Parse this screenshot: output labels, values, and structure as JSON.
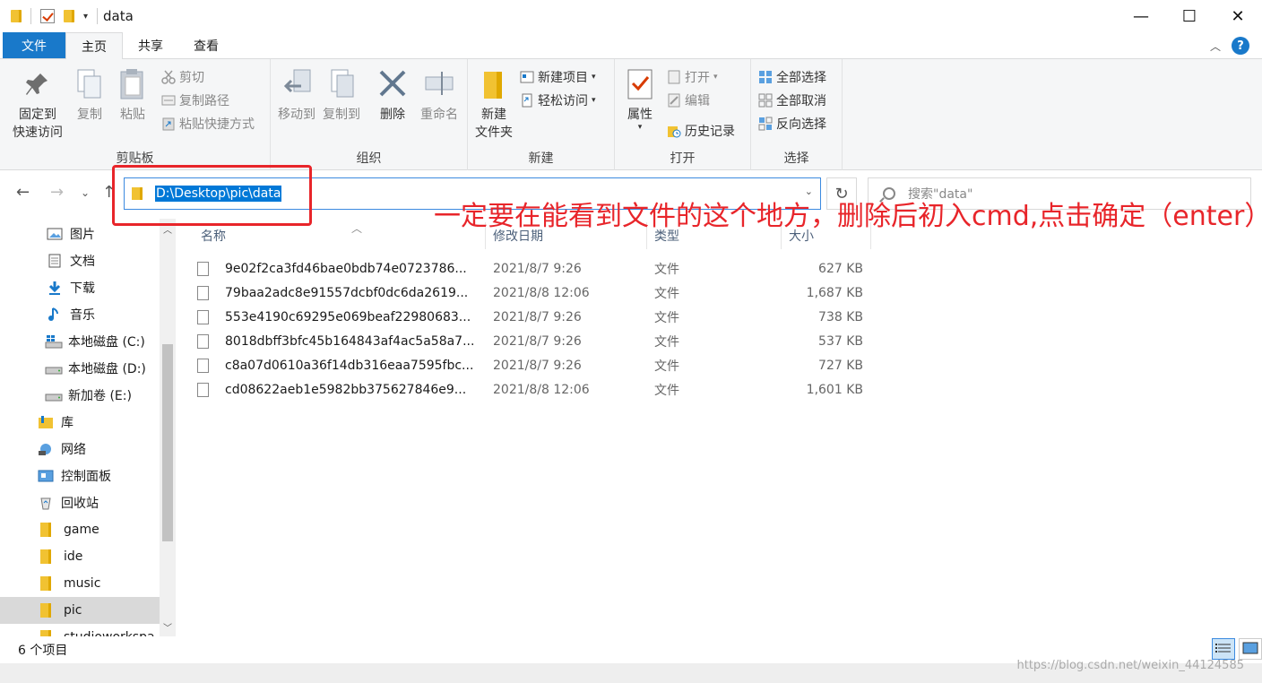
{
  "window": {
    "title": "data",
    "controls": {
      "minimize": "—",
      "maximize": "☐",
      "close": "✕"
    }
  },
  "ribbon_tabs": [
    {
      "label": "文件"
    },
    {
      "label": "主页"
    },
    {
      "label": "共享"
    },
    {
      "label": "查看"
    }
  ],
  "ribbon": {
    "clipboard": {
      "pin_line1": "固定到",
      "pin_line2": "快速访问",
      "copy": "复制",
      "paste": "粘贴",
      "cut": "剪切",
      "copy_path": "复制路径",
      "paste_shortcut": "粘贴快捷方式",
      "label": "剪贴板"
    },
    "organize": {
      "move_to": "移动到",
      "copy_to": "复制到",
      "delete": "删除",
      "rename": "重命名",
      "label": "组织"
    },
    "new": {
      "new_folder_line1": "新建",
      "new_folder_line2": "文件夹",
      "new_item": "新建项目",
      "easy_access": "轻松访问",
      "label": "新建"
    },
    "open": {
      "properties": "属性",
      "open": "打开",
      "edit": "编辑",
      "history": "历史记录",
      "label": "打开"
    },
    "select": {
      "select_all": "全部选择",
      "select_none": "全部取消",
      "invert": "反向选择",
      "label": "选择"
    }
  },
  "address_bar": {
    "path": "D:\\Desktop\\pic\\data"
  },
  "search": {
    "placeholder": "搜索\"data\""
  },
  "annotation": "一定要在能看到文件的这个地方，删除后初入cmd,点击确定（enter）",
  "nav_pane": [
    {
      "label": "图片"
    },
    {
      "label": "文档"
    },
    {
      "label": "下载"
    },
    {
      "label": "音乐"
    },
    {
      "label": "本地磁盘 (C:)"
    },
    {
      "label": "本地磁盘 (D:)"
    },
    {
      "label": "新加卷 (E:)"
    },
    {
      "label": "库"
    },
    {
      "label": "网络"
    },
    {
      "label": "控制面板"
    },
    {
      "label": "回收站"
    },
    {
      "label": "game"
    },
    {
      "label": "ide"
    },
    {
      "label": "music"
    },
    {
      "label": "pic"
    },
    {
      "label": "studioworkspa"
    }
  ],
  "columns": {
    "name": "名称",
    "date": "修改日期",
    "type": "类型",
    "size": "大小"
  },
  "files": [
    {
      "name": "9e02f2ca3fd46bae0bdb74e0723786...",
      "date": "2021/8/7 9:26",
      "type": "文件",
      "size": "627 KB"
    },
    {
      "name": "79baa2adc8e91557dcbf0dc6da2619...",
      "date": "2021/8/8 12:06",
      "type": "文件",
      "size": "1,687 KB"
    },
    {
      "name": "553e4190c69295e069beaf22980683...",
      "date": "2021/8/7 9:26",
      "type": "文件",
      "size": "738 KB"
    },
    {
      "name": "8018dbff3bfc45b164843af4ac5a58a7...",
      "date": "2021/8/7 9:26",
      "type": "文件",
      "size": "537 KB"
    },
    {
      "name": "c8a07d0610a36f14db316eaa7595fbc...",
      "date": "2021/8/7 9:26",
      "type": "文件",
      "size": "727 KB"
    },
    {
      "name": "cd08622aeb1e5982bb375627846e9...",
      "date": "2021/8/8 12:06",
      "type": "文件",
      "size": "1,601 KB"
    }
  ],
  "status": {
    "item_count": "6 个项目"
  },
  "watermark": "https://blog.csdn.net/weixin_44124585",
  "colors": {
    "accent": "#1979ca",
    "annotation_red": "#e8252a",
    "selection": "#0078d7"
  }
}
